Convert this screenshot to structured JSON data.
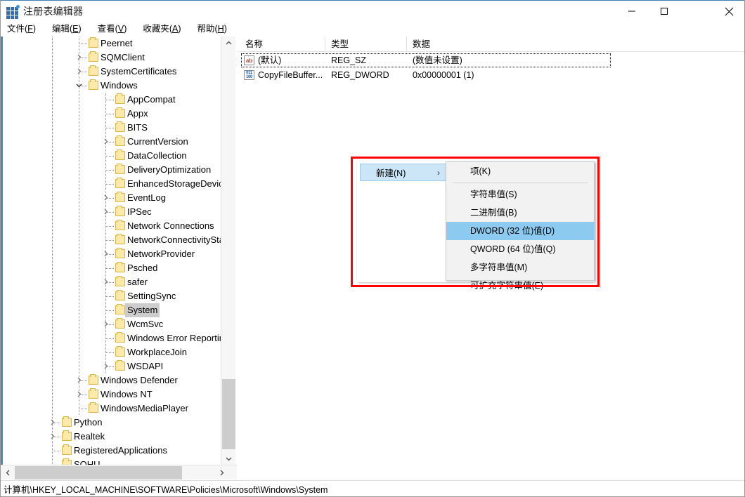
{
  "window": {
    "title": "注册表编辑器",
    "icon": "registry-grid-icon",
    "controls": {
      "minimize": "minimize-icon",
      "maximize": "maximize-icon",
      "close": "close-icon"
    }
  },
  "menubar": {
    "items": [
      {
        "label": "文件(F)",
        "text": "文件(",
        "accel": "F",
        "tail": ")"
      },
      {
        "label": "编辑(E)",
        "text": "编辑(",
        "accel": "E",
        "tail": ")"
      },
      {
        "label": "查看(V)",
        "text": "查看(",
        "accel": "V",
        "tail": ")"
      },
      {
        "label": "收藏夹(A)",
        "text": "收藏夹(",
        "accel": "A",
        "tail": ")"
      },
      {
        "label": "帮助(H)",
        "text": "帮助(",
        "accel": "H",
        "tail": ")"
      }
    ]
  },
  "tree": {
    "selected": "System",
    "items": [
      {
        "label": "Peernet",
        "indent": 2,
        "expander": "none"
      },
      {
        "label": "SQMClient",
        "indent": 2,
        "expander": "collapsed"
      },
      {
        "label": "SystemCertificates",
        "indent": 2,
        "expander": "collapsed"
      },
      {
        "label": "Windows",
        "indent": 2,
        "expander": "expanded"
      },
      {
        "label": "AppCompat",
        "indent": 3,
        "expander": "none"
      },
      {
        "label": "Appx",
        "indent": 3,
        "expander": "none"
      },
      {
        "label": "BITS",
        "indent": 3,
        "expander": "none"
      },
      {
        "label": "CurrentVersion",
        "indent": 3,
        "expander": "collapsed"
      },
      {
        "label": "DataCollection",
        "indent": 3,
        "expander": "none"
      },
      {
        "label": "DeliveryOptimization",
        "indent": 3,
        "expander": "none"
      },
      {
        "label": "EnhancedStorageDevices",
        "indent": 3,
        "expander": "none"
      },
      {
        "label": "EventLog",
        "indent": 3,
        "expander": "collapsed"
      },
      {
        "label": "IPSec",
        "indent": 3,
        "expander": "collapsed"
      },
      {
        "label": "Network Connections",
        "indent": 3,
        "expander": "none"
      },
      {
        "label": "NetworkConnectivityStatusI",
        "indent": 3,
        "expander": "none"
      },
      {
        "label": "NetworkProvider",
        "indent": 3,
        "expander": "collapsed"
      },
      {
        "label": "Psched",
        "indent": 3,
        "expander": "none"
      },
      {
        "label": "safer",
        "indent": 3,
        "expander": "collapsed"
      },
      {
        "label": "SettingSync",
        "indent": 3,
        "expander": "none"
      },
      {
        "label": "System",
        "indent": 3,
        "expander": "none",
        "selected": true
      },
      {
        "label": "WcmSvc",
        "indent": 3,
        "expander": "collapsed"
      },
      {
        "label": "Windows Error Reporting",
        "indent": 3,
        "expander": "none"
      },
      {
        "label": "WorkplaceJoin",
        "indent": 3,
        "expander": "none"
      },
      {
        "label": "WSDAPI",
        "indent": 3,
        "expander": "collapsed"
      },
      {
        "label": "Windows Defender",
        "indent": 2,
        "expander": "collapsed"
      },
      {
        "label": "Windows NT",
        "indent": 2,
        "expander": "collapsed"
      },
      {
        "label": "WindowsMediaPlayer",
        "indent": 2,
        "expander": "none"
      },
      {
        "label": "Python",
        "indent": 1,
        "expander": "collapsed"
      },
      {
        "label": "Realtek",
        "indent": 1,
        "expander": "collapsed"
      },
      {
        "label": "RegisteredApplications",
        "indent": 1,
        "expander": "none"
      },
      {
        "label": "SOHU",
        "indent": 1,
        "expander": "none"
      }
    ]
  },
  "listview": {
    "columns": [
      {
        "label": "名称"
      },
      {
        "label": "类型"
      },
      {
        "label": "数据"
      }
    ],
    "rows": [
      {
        "icon": "string-value-icon",
        "name": "(默认)",
        "type": "REG_SZ",
        "data": "(数值未设置)",
        "focused": true
      },
      {
        "icon": "dword-value-icon",
        "name": "CopyFileBuffer...",
        "type": "REG_DWORD",
        "data": "0x00000001 (1)",
        "focused": false
      }
    ]
  },
  "context_menu": {
    "parent": {
      "label": "新建(N)",
      "arrow": "chevron-right-icon",
      "highlighted": true
    },
    "submenu": [
      {
        "label": "项(K)",
        "highlighted": false,
        "separator_after": true
      },
      {
        "label": "字符串值(S)",
        "highlighted": false
      },
      {
        "label": "二进制值(B)",
        "highlighted": false
      },
      {
        "label": "DWORD (32 位)值(D)",
        "highlighted": true
      },
      {
        "label": "QWORD (64 位)值(Q)",
        "highlighted": false
      },
      {
        "label": "多字符串值(M)",
        "highlighted": false
      },
      {
        "label": "可扩充字符串值(E)",
        "highlighted": false
      }
    ]
  },
  "statusbar": {
    "path": "计算机\\HKEY_LOCAL_MACHINE\\SOFTWARE\\Policies\\Microsoft\\Windows\\System"
  },
  "scrollbars": {
    "tree_vertical": {
      "up": "chevron-up-icon",
      "down": "chevron-down-icon"
    },
    "tree_horizontal": {
      "left": "chevron-left-icon",
      "right": "chevron-right-icon"
    }
  },
  "colors": {
    "accent_blue": "#4a88bf",
    "annotation_red": "#ff0000",
    "menu_highlight": "#8ccaf0",
    "parent_highlight": "#cde6f7",
    "selection_gray": "#cdcdcd",
    "folder_yellow": "#fde9a9"
  }
}
